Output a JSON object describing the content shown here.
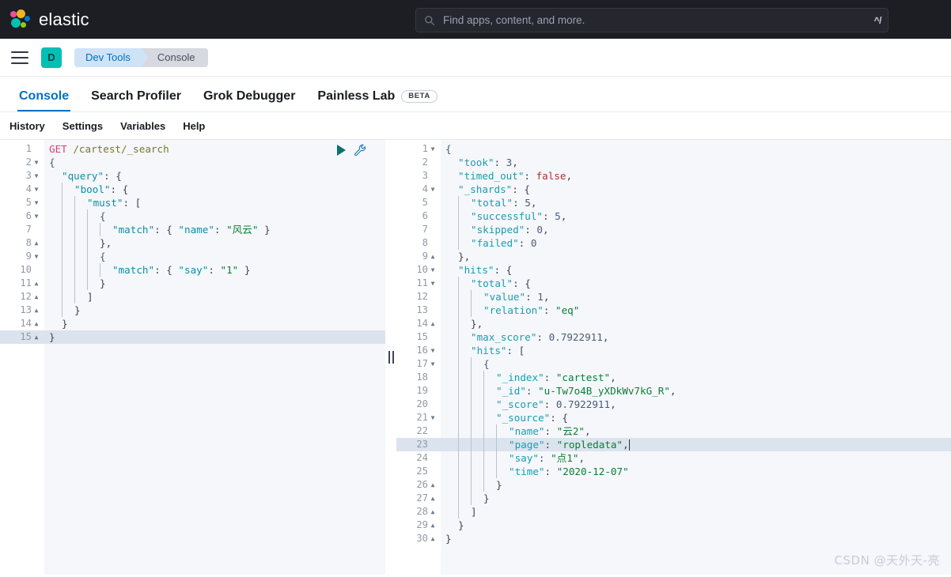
{
  "header": {
    "brand": "elastic",
    "logo_icon": "elastic-logo",
    "search": {
      "icon": "search-icon",
      "placeholder": "Find apps, content, and more.",
      "value": "",
      "shortcut": "^/"
    }
  },
  "breadcrumb_bar": {
    "menu_icon": "hamburger-menu-icon",
    "app_initial": "D",
    "crumbs": [
      {
        "label": "Dev Tools"
      },
      {
        "label": "Console"
      }
    ]
  },
  "tabs": [
    {
      "label": "Console",
      "active": true,
      "badge": ""
    },
    {
      "label": "Search Profiler",
      "active": false,
      "badge": ""
    },
    {
      "label": "Grok Debugger",
      "active": false,
      "badge": ""
    },
    {
      "label": "Painless Lab",
      "active": false,
      "badge": "BETA"
    }
  ],
  "submenu": [
    {
      "label": "History"
    },
    {
      "label": "Settings"
    },
    {
      "label": "Variables"
    },
    {
      "label": "Help"
    }
  ],
  "request_editor": {
    "play_icon": "play-triangle-icon",
    "wrench_icon": "wrench-icon",
    "active_line": 15,
    "lines": [
      {
        "n": 1,
        "fold": "",
        "indent": 0,
        "tokens": [
          {
            "t": "GET",
            "c": "k-method"
          },
          {
            "t": " ",
            "c": "k-punc"
          },
          {
            "t": "/cartest/_search",
            "c": "k-url"
          }
        ]
      },
      {
        "n": 2,
        "fold": "v",
        "indent": 0,
        "tokens": [
          {
            "t": "{",
            "c": "k-brace"
          }
        ]
      },
      {
        "n": 3,
        "fold": "v",
        "indent": 1,
        "tokens": [
          {
            "t": "\"query\"",
            "c": "k-key"
          },
          {
            "t": ": {",
            "c": "k-punc"
          }
        ]
      },
      {
        "n": 4,
        "fold": "v",
        "indent": 2,
        "tokens": [
          {
            "t": "\"bool\"",
            "c": "k-key"
          },
          {
            "t": ": {",
            "c": "k-punc"
          }
        ]
      },
      {
        "n": 5,
        "fold": "v",
        "indent": 3,
        "tokens": [
          {
            "t": "\"must\"",
            "c": "k-key"
          },
          {
            "t": ": [",
            "c": "k-punc"
          }
        ]
      },
      {
        "n": 6,
        "fold": "v",
        "indent": 4,
        "tokens": [
          {
            "t": "{",
            "c": "k-brace"
          }
        ]
      },
      {
        "n": 7,
        "fold": "",
        "indent": 5,
        "tokens": [
          {
            "t": "\"match\"",
            "c": "k-key"
          },
          {
            "t": ": { ",
            "c": "k-punc"
          },
          {
            "t": "\"name\"",
            "c": "k-key"
          },
          {
            "t": ": ",
            "c": "k-punc"
          },
          {
            "t": "\"风云\"",
            "c": "k-str"
          },
          {
            "t": " }",
            "c": "k-punc"
          }
        ]
      },
      {
        "n": 8,
        "fold": "^",
        "indent": 4,
        "tokens": [
          {
            "t": "},",
            "c": "k-punc"
          }
        ]
      },
      {
        "n": 9,
        "fold": "v",
        "indent": 4,
        "tokens": [
          {
            "t": "{",
            "c": "k-brace"
          }
        ]
      },
      {
        "n": 10,
        "fold": "",
        "indent": 5,
        "tokens": [
          {
            "t": "\"match\"",
            "c": "k-key"
          },
          {
            "t": ": { ",
            "c": "k-punc"
          },
          {
            "t": "\"say\"",
            "c": "k-key"
          },
          {
            "t": ": ",
            "c": "k-punc"
          },
          {
            "t": "\"1\"",
            "c": "k-str"
          },
          {
            "t": " }",
            "c": "k-punc"
          }
        ]
      },
      {
        "n": 11,
        "fold": "^",
        "indent": 4,
        "tokens": [
          {
            "t": "}",
            "c": "k-punc"
          }
        ]
      },
      {
        "n": 12,
        "fold": "^",
        "indent": 3,
        "tokens": [
          {
            "t": "]",
            "c": "k-punc"
          }
        ]
      },
      {
        "n": 13,
        "fold": "^",
        "indent": 2,
        "tokens": [
          {
            "t": "}",
            "c": "k-punc"
          }
        ]
      },
      {
        "n": 14,
        "fold": "^",
        "indent": 1,
        "tokens": [
          {
            "t": "}",
            "c": "k-punc"
          }
        ]
      },
      {
        "n": 15,
        "fold": "^",
        "indent": 0,
        "tokens": [
          {
            "t": "}",
            "c": "k-punc"
          }
        ]
      }
    ]
  },
  "response_editor": {
    "active_line": 23,
    "lines": [
      {
        "n": 1,
        "fold": "v",
        "indent": 0,
        "tokens": [
          {
            "t": "{",
            "c": "k-brace"
          }
        ]
      },
      {
        "n": 2,
        "fold": "",
        "indent": 1,
        "tokens": [
          {
            "t": "\"took\"",
            "c": "k-key2"
          },
          {
            "t": ": ",
            "c": "k-punc"
          },
          {
            "t": "3",
            "c": "k-num"
          },
          {
            "t": ",",
            "c": "k-punc"
          }
        ]
      },
      {
        "n": 3,
        "fold": "",
        "indent": 1,
        "tokens": [
          {
            "t": "\"timed_out\"",
            "c": "k-key2"
          },
          {
            "t": ": ",
            "c": "k-punc"
          },
          {
            "t": "false",
            "c": "k-bool"
          },
          {
            "t": ",",
            "c": "k-punc"
          }
        ]
      },
      {
        "n": 4,
        "fold": "v",
        "indent": 1,
        "tokens": [
          {
            "t": "\"_shards\"",
            "c": "k-key2"
          },
          {
            "t": ": {",
            "c": "k-punc"
          }
        ]
      },
      {
        "n": 5,
        "fold": "",
        "indent": 2,
        "tokens": [
          {
            "t": "\"total\"",
            "c": "k-key2"
          },
          {
            "t": ": ",
            "c": "k-punc"
          },
          {
            "t": "5",
            "c": "k-num"
          },
          {
            "t": ",",
            "c": "k-punc"
          }
        ]
      },
      {
        "n": 6,
        "fold": "",
        "indent": 2,
        "tokens": [
          {
            "t": "\"successful\"",
            "c": "k-key2"
          },
          {
            "t": ": ",
            "c": "k-punc"
          },
          {
            "t": "5",
            "c": "k-num"
          },
          {
            "t": ",",
            "c": "k-punc"
          }
        ]
      },
      {
        "n": 7,
        "fold": "",
        "indent": 2,
        "tokens": [
          {
            "t": "\"skipped\"",
            "c": "k-key2"
          },
          {
            "t": ": ",
            "c": "k-punc"
          },
          {
            "t": "0",
            "c": "k-num"
          },
          {
            "t": ",",
            "c": "k-punc"
          }
        ]
      },
      {
        "n": 8,
        "fold": "",
        "indent": 2,
        "tokens": [
          {
            "t": "\"failed\"",
            "c": "k-key2"
          },
          {
            "t": ": ",
            "c": "k-punc"
          },
          {
            "t": "0",
            "c": "k-num"
          }
        ]
      },
      {
        "n": 9,
        "fold": "^",
        "indent": 1,
        "tokens": [
          {
            "t": "},",
            "c": "k-punc"
          }
        ]
      },
      {
        "n": 10,
        "fold": "v",
        "indent": 1,
        "tokens": [
          {
            "t": "\"hits\"",
            "c": "k-key2"
          },
          {
            "t": ": {",
            "c": "k-punc"
          }
        ]
      },
      {
        "n": 11,
        "fold": "v",
        "indent": 2,
        "tokens": [
          {
            "t": "\"total\"",
            "c": "k-key2"
          },
          {
            "t": ": {",
            "c": "k-punc"
          }
        ]
      },
      {
        "n": 12,
        "fold": "",
        "indent": 3,
        "tokens": [
          {
            "t": "\"value\"",
            "c": "k-key2"
          },
          {
            "t": ": ",
            "c": "k-punc"
          },
          {
            "t": "1",
            "c": "k-num"
          },
          {
            "t": ",",
            "c": "k-punc"
          }
        ]
      },
      {
        "n": 13,
        "fold": "",
        "indent": 3,
        "tokens": [
          {
            "t": "\"relation\"",
            "c": "k-key2"
          },
          {
            "t": ": ",
            "c": "k-punc"
          },
          {
            "t": "\"eq\"",
            "c": "k-str"
          }
        ]
      },
      {
        "n": 14,
        "fold": "^",
        "indent": 2,
        "tokens": [
          {
            "t": "},",
            "c": "k-punc"
          }
        ]
      },
      {
        "n": 15,
        "fold": "",
        "indent": 2,
        "tokens": [
          {
            "t": "\"max_score\"",
            "c": "k-key2"
          },
          {
            "t": ": ",
            "c": "k-punc"
          },
          {
            "t": "0.7922911",
            "c": "k-num"
          },
          {
            "t": ",",
            "c": "k-punc"
          }
        ]
      },
      {
        "n": 16,
        "fold": "v",
        "indent": 2,
        "tokens": [
          {
            "t": "\"hits\"",
            "c": "k-key2"
          },
          {
            "t": ": [",
            "c": "k-punc"
          }
        ]
      },
      {
        "n": 17,
        "fold": "v",
        "indent": 3,
        "tokens": [
          {
            "t": "{",
            "c": "k-brace"
          }
        ]
      },
      {
        "n": 18,
        "fold": "",
        "indent": 4,
        "tokens": [
          {
            "t": "\"_index\"",
            "c": "k-key2"
          },
          {
            "t": ": ",
            "c": "k-punc"
          },
          {
            "t": "\"cartest\"",
            "c": "k-str"
          },
          {
            "t": ",",
            "c": "k-punc"
          }
        ]
      },
      {
        "n": 19,
        "fold": "",
        "indent": 4,
        "tokens": [
          {
            "t": "\"_id\"",
            "c": "k-key2"
          },
          {
            "t": ": ",
            "c": "k-punc"
          },
          {
            "t": "\"u-Tw7o4B_yXDkWv7kG_R\"",
            "c": "k-str"
          },
          {
            "t": ",",
            "c": "k-punc"
          }
        ]
      },
      {
        "n": 20,
        "fold": "",
        "indent": 4,
        "tokens": [
          {
            "t": "\"_score\"",
            "c": "k-key2"
          },
          {
            "t": ": ",
            "c": "k-punc"
          },
          {
            "t": "0.7922911",
            "c": "k-num"
          },
          {
            "t": ",",
            "c": "k-punc"
          }
        ]
      },
      {
        "n": 21,
        "fold": "v",
        "indent": 4,
        "tokens": [
          {
            "t": "\"_source\"",
            "c": "k-key2"
          },
          {
            "t": ": {",
            "c": "k-punc"
          }
        ]
      },
      {
        "n": 22,
        "fold": "",
        "indent": 5,
        "tokens": [
          {
            "t": "\"name\"",
            "c": "k-key2"
          },
          {
            "t": ": ",
            "c": "k-punc"
          },
          {
            "t": "\"云2\"",
            "c": "k-str"
          },
          {
            "t": ",",
            "c": "k-punc"
          }
        ]
      },
      {
        "n": 23,
        "fold": "",
        "indent": 5,
        "tokens": [
          {
            "t": "\"page\"",
            "c": "k-key2"
          },
          {
            "t": ": ",
            "c": "k-punc"
          },
          {
            "t": "\"ropledata\"",
            "c": "k-str"
          },
          {
            "t": ",",
            "c": "k-punc"
          }
        ],
        "caret": true
      },
      {
        "n": 24,
        "fold": "",
        "indent": 5,
        "tokens": [
          {
            "t": "\"say\"",
            "c": "k-key2"
          },
          {
            "t": ": ",
            "c": "k-punc"
          },
          {
            "t": "\"点1\"",
            "c": "k-str"
          },
          {
            "t": ",",
            "c": "k-punc"
          }
        ]
      },
      {
        "n": 25,
        "fold": "",
        "indent": 5,
        "tokens": [
          {
            "t": "\"time\"",
            "c": "k-key2"
          },
          {
            "t": ": ",
            "c": "k-punc"
          },
          {
            "t": "\"2020-12-07\"",
            "c": "k-str"
          }
        ]
      },
      {
        "n": 26,
        "fold": "^",
        "indent": 4,
        "tokens": [
          {
            "t": "}",
            "c": "k-punc"
          }
        ]
      },
      {
        "n": 27,
        "fold": "^",
        "indent": 3,
        "tokens": [
          {
            "t": "}",
            "c": "k-punc"
          }
        ]
      },
      {
        "n": 28,
        "fold": "^",
        "indent": 2,
        "tokens": [
          {
            "t": "]",
            "c": "k-punc"
          }
        ]
      },
      {
        "n": 29,
        "fold": "^",
        "indent": 1,
        "tokens": [
          {
            "t": "}",
            "c": "k-punc"
          }
        ]
      },
      {
        "n": 30,
        "fold": "^",
        "indent": 0,
        "tokens": [
          {
            "t": "}",
            "c": "k-punc"
          }
        ]
      }
    ]
  },
  "splitter": {
    "name": "pane-splitter"
  },
  "watermark": "CSDN @天外天-亮",
  "colors": {
    "header_bg": "#1d1e24",
    "accent_blue": "#0071c2",
    "teal": "#00bfb3",
    "editor_bg": "#f5f7fa",
    "active_line": "#dbe3ee"
  }
}
